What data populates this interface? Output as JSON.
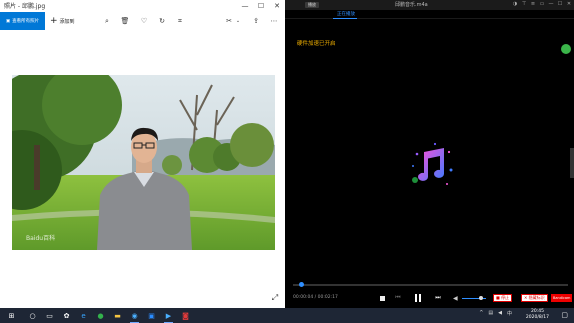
{
  "photos": {
    "title": "照片 - 邱鹏.jpg",
    "toolbar": {
      "edit_label": "查看所有照片",
      "add_label": "添加到"
    },
    "watermark": "Baidu百科"
  },
  "player": {
    "menu_label": "播放",
    "file_title": "邱鹏音乐.m4a",
    "tab_label": "正在播放",
    "accel_text": "硬件加速已开启",
    "time_current": "00:00:04",
    "time_total": "00:02:17",
    "progress": 0.03,
    "volume": 0.8,
    "stop_rec_label": "停止",
    "close_cap_label": "隐藏标识",
    "brand_label": "Bandicam"
  },
  "taskbar": {
    "time": "20:45",
    "date": "2020/8/17"
  },
  "colors": {
    "accent": "#0078d7",
    "player_accent": "#2f8fff",
    "accel_text": "#f2b100",
    "taskbar": "#1e2635"
  }
}
